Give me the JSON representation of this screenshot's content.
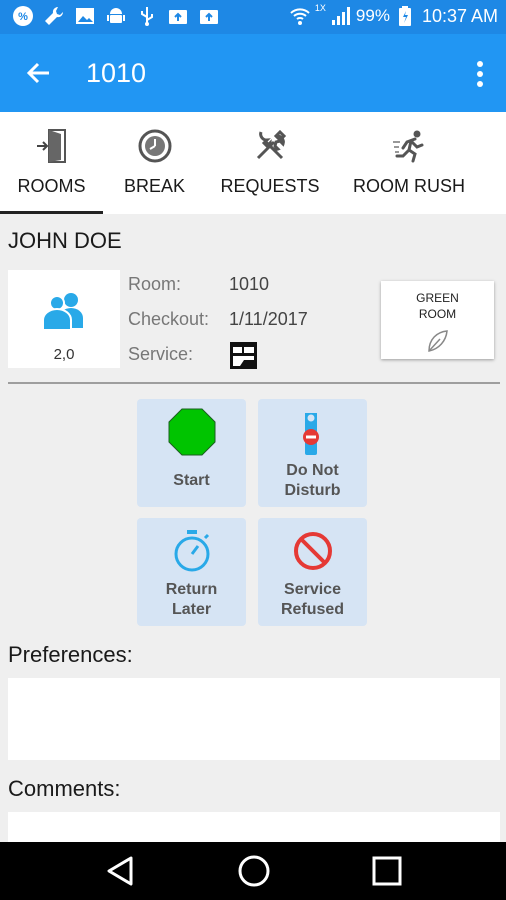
{
  "status_bar": {
    "left_icons": [
      "percent-icon",
      "wrench-icon",
      "image-icon",
      "android-icon",
      "usb-icon",
      "photo-upload-icon",
      "photo-upload-icon"
    ],
    "network_label": "1X",
    "battery_percent": "99%",
    "time": "10:37 AM"
  },
  "app_bar": {
    "title": "1010"
  },
  "tabs": [
    {
      "label": "ROOMS",
      "icon": "door-exit-icon",
      "selected": true
    },
    {
      "label": "BREAK",
      "icon": "clock-icon",
      "selected": false
    },
    {
      "label": "REQUESTS",
      "icon": "tools-icon",
      "selected": false
    },
    {
      "label": "ROOM RUSH",
      "icon": "running-person-icon",
      "selected": false
    }
  ],
  "guest": {
    "name": "JOHN DOE",
    "count": "2,0"
  },
  "room_info": {
    "room_label": "Room:",
    "room_value": "1010",
    "checkout_label": "Checkout:",
    "checkout_value": "1/11/2017",
    "service_label": "Service:",
    "service_icon": "bed-icon"
  },
  "green_room": {
    "label": "GREEN ROOM",
    "icon": "leaf-icon"
  },
  "actions": {
    "start": "Start",
    "dnd_line1": "Do Not",
    "dnd_line2": "Disturb",
    "return_line1": "Return",
    "return_line2": "Later",
    "refused_line1": "Service",
    "refused_line2": "Refused"
  },
  "preferences": {
    "label": "Preferences:",
    "value": ""
  },
  "comments": {
    "label": "Comments:",
    "value": ""
  },
  "colors": {
    "status_bar": "#1e88e5",
    "app_bar": "#2196f3",
    "action_tile": "#d6e4f4",
    "stop_green": "#00c400",
    "refused_red": "#e53935",
    "guest_blue": "#29a9e8"
  }
}
